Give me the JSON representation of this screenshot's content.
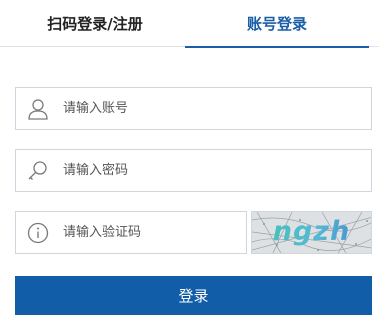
{
  "tabs": {
    "scan_label": "扫码登录/注册",
    "account_label": "账号登录"
  },
  "form": {
    "account_placeholder": "请输入账号",
    "password_placeholder": "请输入密码",
    "captcha_placeholder": "请输入验证码",
    "captcha_text": "ngzh",
    "login_label": "登录"
  },
  "icons": {
    "account": "user-icon",
    "password": "key-icon",
    "captcha": "info-icon"
  },
  "colors": {
    "accent": "#1a5ea8",
    "button": "#125da8",
    "border": "#cfd6de"
  }
}
